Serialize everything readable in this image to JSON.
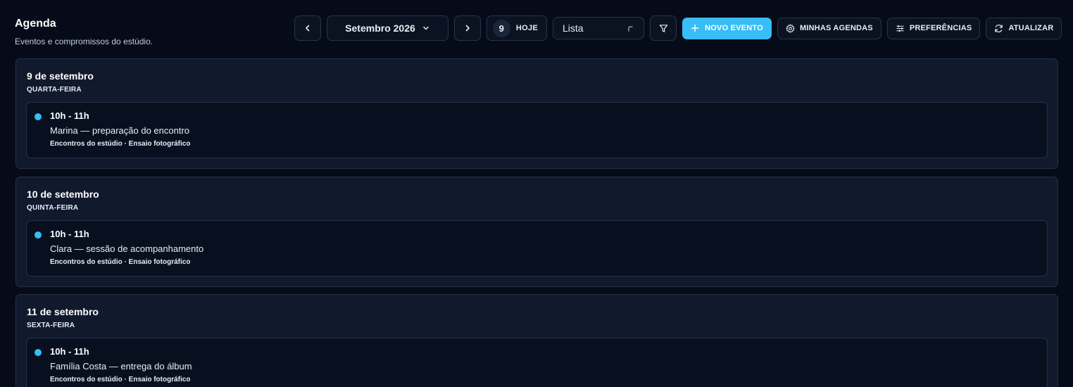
{
  "header": {
    "title": "Agenda",
    "subtitle": "Eventos e compromissos do estúdio."
  },
  "toolbar": {
    "prev_icon": "chevron-left-icon",
    "month_label": "Setembro 2026",
    "month_icon": "chevron-down-icon",
    "next_icon": "chevron-right-icon",
    "today_day": "9",
    "today_label": "HOJE",
    "view_value": "Lista",
    "filter_icon": "filter-icon",
    "new_event_label": "NOVO EVENTO",
    "my_calendars_label": "MINHAS AGENDAS",
    "preferences_label": "PREFERÊNCIAS",
    "refresh_label": "ATUALIZAR"
  },
  "days": [
    {
      "date": "9 de setembro",
      "weekday": "QUARTA-FEIRA",
      "events": [
        {
          "time": "10h - 11h",
          "title": "Marina — preparação do encontro",
          "meta": "Encontros do estúdio · Ensaio fotográfico"
        }
      ]
    },
    {
      "date": "10 de setembro",
      "weekday": "QUINTA-FEIRA",
      "events": [
        {
          "time": "10h - 11h",
          "title": "Clara — sessão de acompanhamento",
          "meta": "Encontros do estúdio · Ensaio fotográfico"
        }
      ]
    },
    {
      "date": "11 de setembro",
      "weekday": "SEXTA-FEIRA",
      "events": [
        {
          "time": "10h - 11h",
          "title": "Família Costa — entrega do álbum",
          "meta": "Encontros do estúdio · Ensaio fotográfico"
        }
      ]
    }
  ],
  "colors": {
    "accent": "#38bdf8",
    "background": "#050b18",
    "card": "#111a2d"
  }
}
